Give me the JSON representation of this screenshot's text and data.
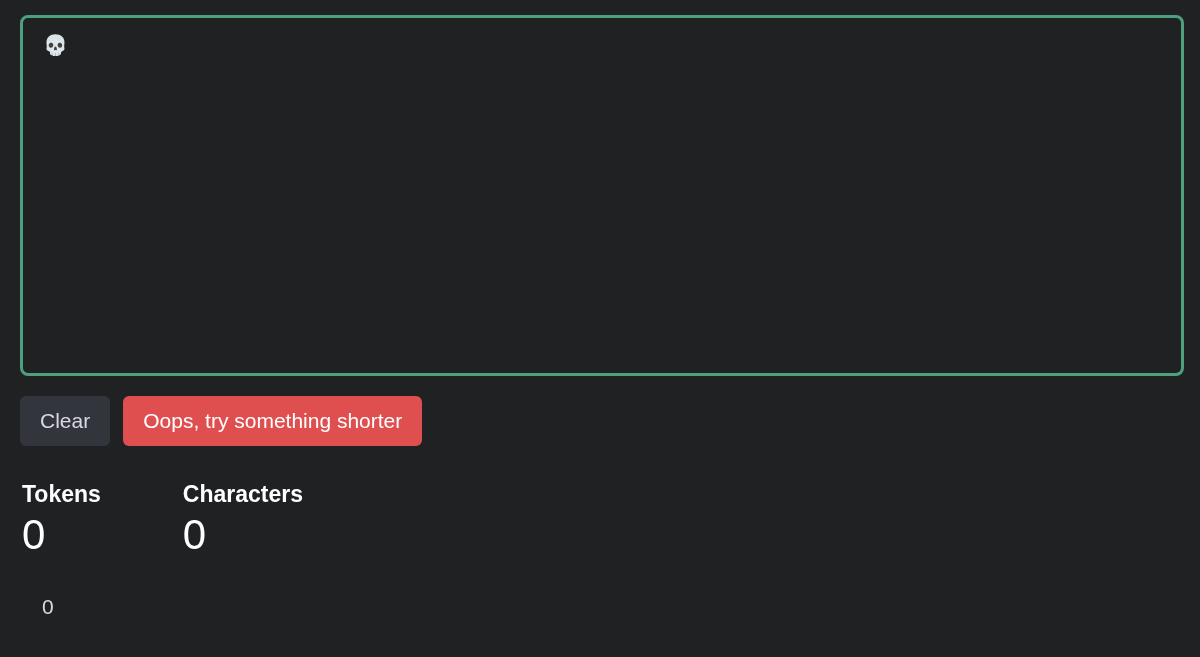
{
  "editor": {
    "value": "💀"
  },
  "buttons": [
    {
      "label": "Clear",
      "kind": "neutral"
    },
    {
      "label": "Oops, try something shorter",
      "kind": "error"
    }
  ],
  "stats": [
    {
      "label": "Tokens",
      "value": "0"
    },
    {
      "label": "Characters",
      "value": "0"
    }
  ],
  "footer_value": "0"
}
